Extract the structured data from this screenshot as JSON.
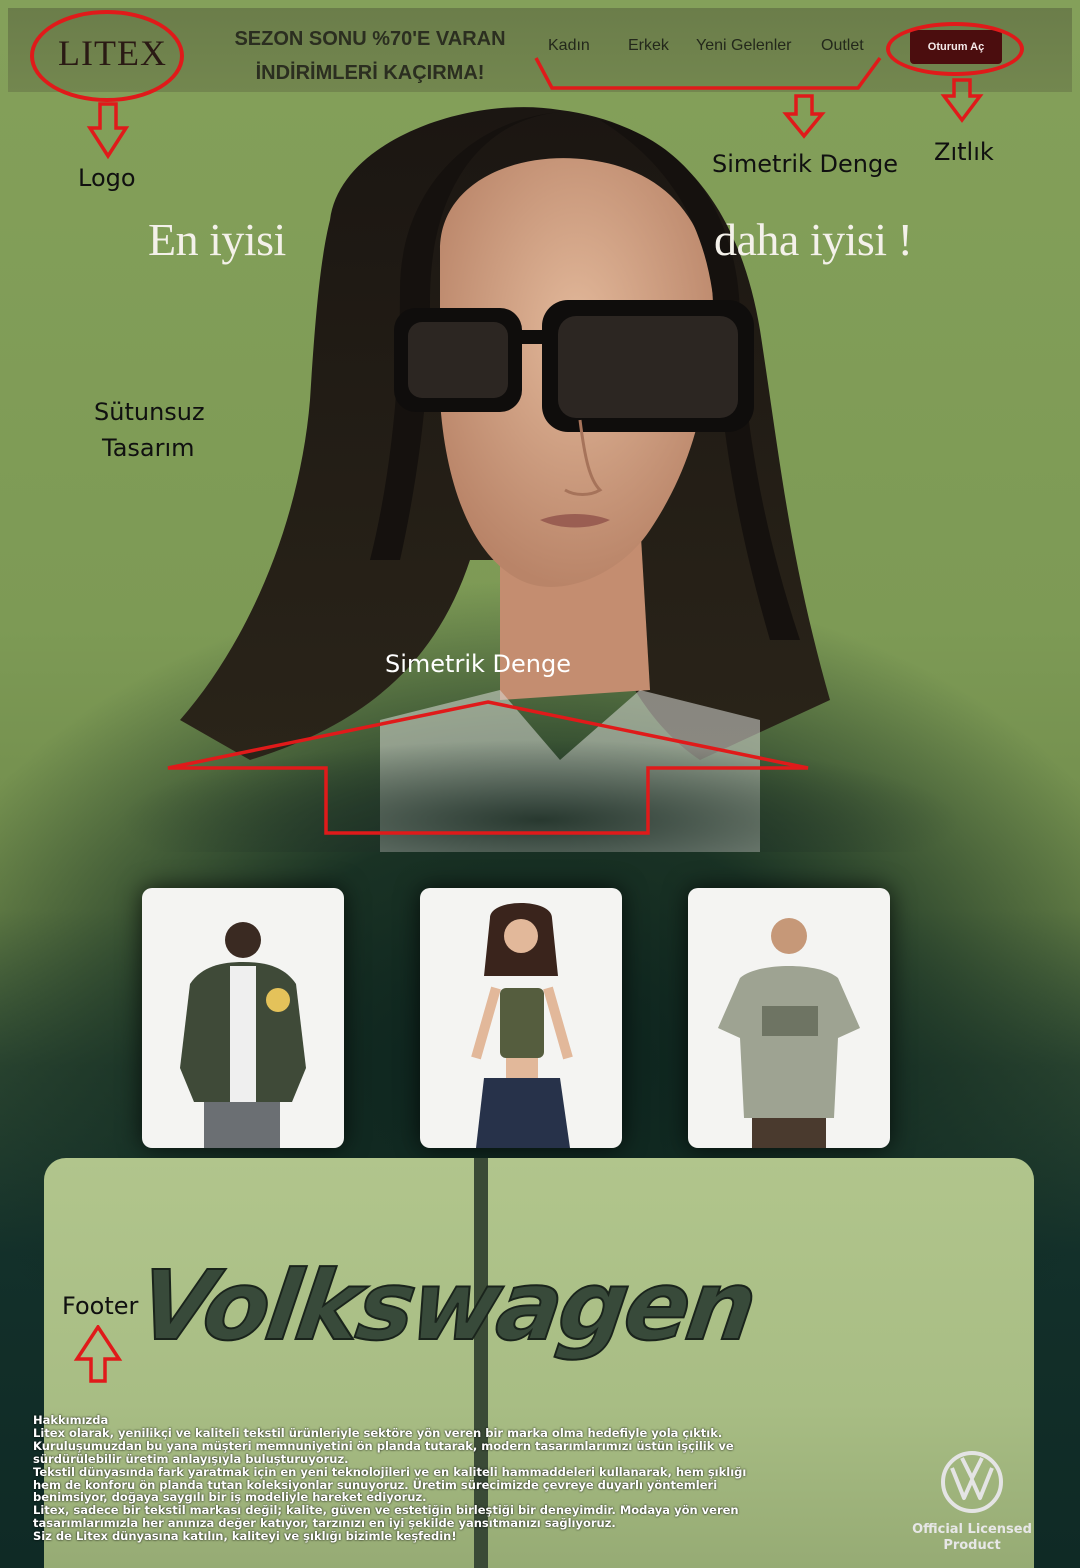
{
  "header": {
    "logo": "LITEX",
    "promo_line1": "SEZON SONU %70'E VARAN",
    "promo_line2": "İNDİRİMLERİ KAÇIRMA!",
    "nav": [
      "Kadın",
      "Erkek",
      "Yeni Gelenler",
      "Outlet"
    ],
    "login_label": "Oturum Aç",
    "login_color": "#4b0d0e"
  },
  "hero": {
    "text_left": "En iyisi",
    "text_right": "daha iyisi !"
  },
  "annotations": {
    "logo": "Logo",
    "symmetry_top": "Simetrik Denge",
    "contrast": "Zıtlık",
    "columnless_1": "Sütunsuz",
    "columnless_2": "Tasarım",
    "symmetry_center": "Simetrik Denge",
    "footer": "Footer",
    "annotation_color": "#e01a1a"
  },
  "products": [
    {
      "name": "green varsity jacket"
    },
    {
      "name": "olive crop tank top"
    },
    {
      "name": "sage graphic t-shirt"
    }
  ],
  "footer": {
    "lines": [
      "Hakkımızda",
      "Litex olarak, yenilikçi ve kaliteli tekstil ürünleriyle sektöre yön veren bir marka olma hedefiyle yola çıktık.",
      "Kuruluşumuzdan bu yana müşteri memnuniyetini ön planda tutarak, modern tasarımlarımızı üstün işçilik ve",
      "sürdürülebilir üretim anlayışıyla buluşturuyoruz.",
      "Tekstil dünyasında fark yaratmak için en yeni teknolojileri ve en kaliteli hammaddeleri kullanarak, hem şıklığı",
      "hem de konforu ön planda tutan koleksiyonlar sunuyoruz. Üretim sürecimizde çevreye duyarlı yöntemleri",
      "benimsiyor, doğaya saygılı bir iş modeliyle hareket ediyoruz.",
      "Litex, sadece bir tekstil markası değil; kalite, güven ve estetiğin birleştiği bir deneyimdir. Modaya yön veren",
      "tasarımlarımızla her anınıza değer katıyor, tarzınızı en iyi şekilde yansıtmanızı sağlıyoruz.",
      "Siz de Litex dünyasına katılın, kaliteyi ve şıklığı bizimle keşfedin!"
    ],
    "brand_script": "Volkswagen",
    "licensed_line1": "Official Licensed",
    "licensed_line2": "Product"
  }
}
